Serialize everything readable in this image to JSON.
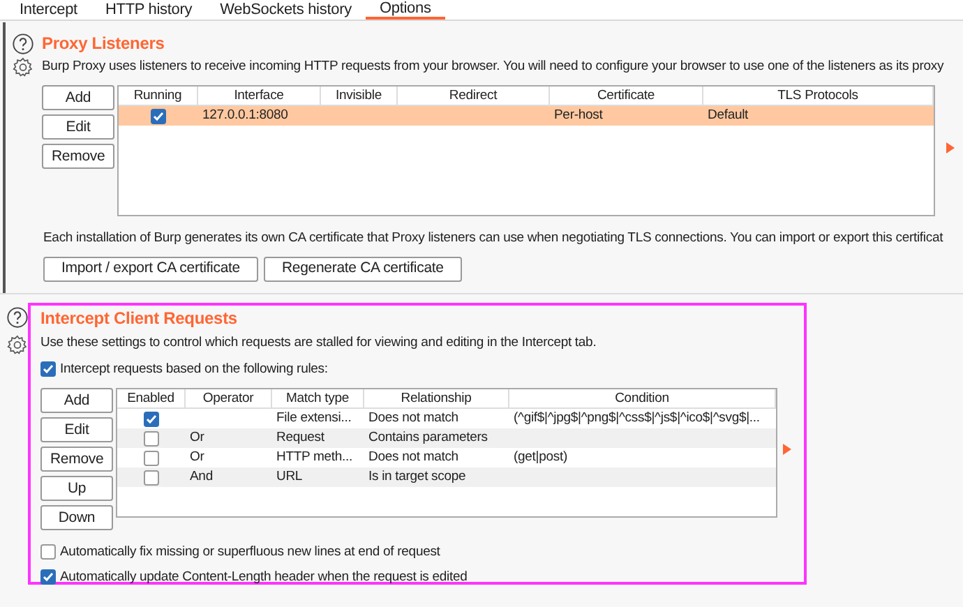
{
  "tabs": [
    {
      "label": "Intercept",
      "selected": false
    },
    {
      "label": "HTTP history",
      "selected": false
    },
    {
      "label": "WebSockets history",
      "selected": false
    },
    {
      "label": "Options",
      "selected": true
    }
  ],
  "proxy_listeners": {
    "title": "Proxy Listeners",
    "description": "Burp Proxy uses listeners to receive incoming HTTP requests from your browser. You will need to configure your browser to use one of the listeners as its proxy",
    "buttons": [
      "Add",
      "Edit",
      "Remove"
    ],
    "table": {
      "columns": [
        "Running",
        "Interface",
        "Invisible",
        "Redirect",
        "Certificate",
        "TLS Protocols"
      ],
      "rows": [
        {
          "running": true,
          "selected": true,
          "cells": [
            "",
            "127.0.0.1:8080",
            "",
            "",
            "Per-host",
            "Default"
          ]
        }
      ]
    },
    "ca_text": "Each installation of Burp generates its own CA certificate that Proxy listeners can use when negotiating TLS connections. You can import or export this certificat",
    "ca_buttons": [
      "Import / export CA certificate",
      "Regenerate CA certificate"
    ]
  },
  "intercept_client_requests": {
    "title": "Intercept Client Requests",
    "description": "Use these settings to control which requests are stalled for viewing and editing in the Intercept tab.",
    "rules_option": {
      "label": "Intercept requests based on the following rules:",
      "checked": true
    },
    "buttons": [
      "Add",
      "Edit",
      "Remove",
      "Up",
      "Down"
    ],
    "table": {
      "columns": [
        "Enabled",
        "Operator",
        "Match type",
        "Relationship",
        "Condition"
      ],
      "rows": [
        {
          "enabled": true,
          "cells": [
            "",
            "",
            "File extensi...",
            "Does not match",
            "(^gif$|^jpg$|^png$|^css$|^js$|^ico$|^svg$|..."
          ]
        },
        {
          "enabled": false,
          "cells": [
            "",
            "Or",
            "Request",
            "Contains parameters",
            ""
          ]
        },
        {
          "enabled": false,
          "cells": [
            "",
            "Or",
            "HTTP meth...",
            "Does not match",
            "(get|post)"
          ]
        },
        {
          "enabled": false,
          "cells": [
            "",
            "And",
            "URL",
            "Is in target scope",
            ""
          ]
        }
      ]
    },
    "options": [
      {
        "label": "Automatically fix missing or superfluous new lines at end of request",
        "checked": false
      },
      {
        "label": "Automatically update Content-Length header when the request is edited",
        "checked": true
      }
    ]
  }
}
